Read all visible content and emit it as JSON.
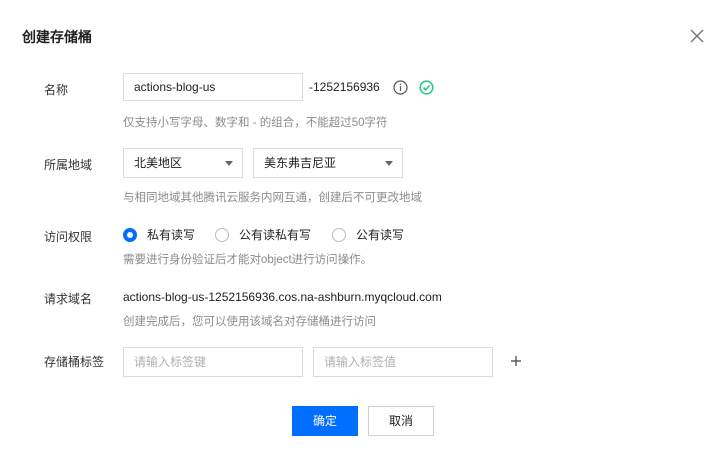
{
  "dialog": {
    "title": "创建存储桶"
  },
  "name": {
    "label": "名称",
    "value": "actions-blog-us",
    "suffix": "-1252156936",
    "hint": "仅支持小写字母、数字和 - 的组合，不能超过50字符"
  },
  "region": {
    "label": "所属地域",
    "area": "北美地区",
    "city": "美东弗吉尼亚",
    "hint": "与相同地域其他腾讯云服务内网互通，创建后不可更改地域"
  },
  "access": {
    "label": "访问权限",
    "options": [
      "私有读写",
      "公有读私有写",
      "公有读写"
    ],
    "selected": "私有读写",
    "hint": "需要进行身份验证后才能对object进行访问操作。"
  },
  "domain": {
    "label": "请求域名",
    "value": "actions-blog-us-1252156936.cos.na-ashburn.myqcloud.com",
    "hint": "创建完成后，您可以使用该域名对存储桶进行访问"
  },
  "tags": {
    "label": "存储桶标签",
    "key_placeholder": "请输入标签键",
    "value_placeholder": "请输入标签值"
  },
  "buttons": {
    "confirm": "确定",
    "cancel": "取消"
  },
  "colors": {
    "primary": "#006eff",
    "success": "#29cc85"
  }
}
